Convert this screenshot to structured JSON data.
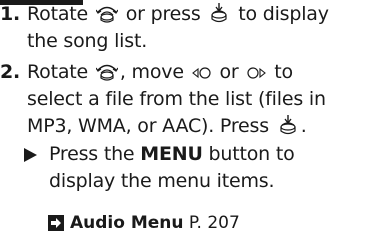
{
  "steps": [
    {
      "number": "1.",
      "line1": {
        "pre": "Rotate",
        "mid": "or press",
        "post": "to display"
      },
      "line2": "the song list."
    },
    {
      "number": "2.",
      "line1": {
        "pre": "Rotate",
        "mid": ", move",
        "or": "or",
        "post": "to"
      },
      "line2": "select a file from the list (files in",
      "line3": {
        "pre": "MP3, WMA, or AAC). Press",
        "post": "."
      }
    }
  ],
  "sub_note": {
    "pre": "Press the",
    "button": "MENU",
    "post": "button to",
    "line2": "display the menu items."
  },
  "reference": {
    "title": "Audio Menu",
    "page": "P. 207"
  },
  "icons": {
    "rotate": "rotate-knob-icon",
    "press": "press-knob-icon",
    "move_left": "move-left-icon",
    "move_right": "move-right-icon",
    "bullet": "triangle-bullet-icon",
    "cross_ref": "cross-reference-arrow-icon"
  },
  "colors": {
    "text": "#1a1a1a",
    "background": "#ffffff"
  }
}
